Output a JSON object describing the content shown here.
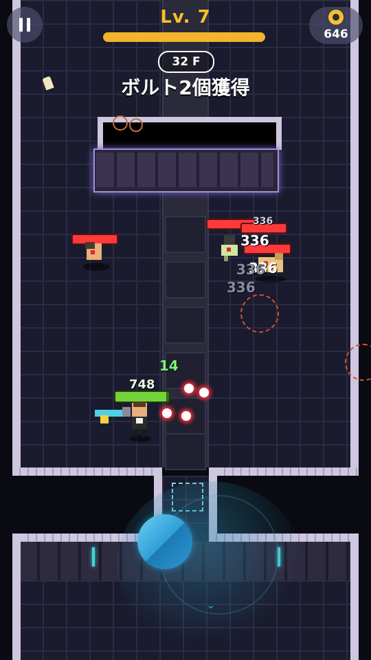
{
  "hud": {
    "level_label": "Lv. 7",
    "xp_progress": 1.0,
    "coins": "646",
    "floor": "32 F",
    "message": "ボルト2個獲得"
  },
  "combat": {
    "enemy_damage": [
      "336",
      "336",
      "336"
    ],
    "faded_damage": [
      "336",
      "336"
    ],
    "heal_number": "14",
    "player_hp": "748",
    "player_hp_fraction": 0.95
  },
  "icons": [
    "pause-icon",
    "bolt-coin-icon",
    "joystick-knob"
  ],
  "colors": {
    "accent_gold": "#f2b42a",
    "wall": "#cfc6e0",
    "floor": "#1a1b2e",
    "enemy_hp": "#ff3a3a",
    "player_hp": "#76d23a",
    "joystick": "#2f9fd6"
  }
}
